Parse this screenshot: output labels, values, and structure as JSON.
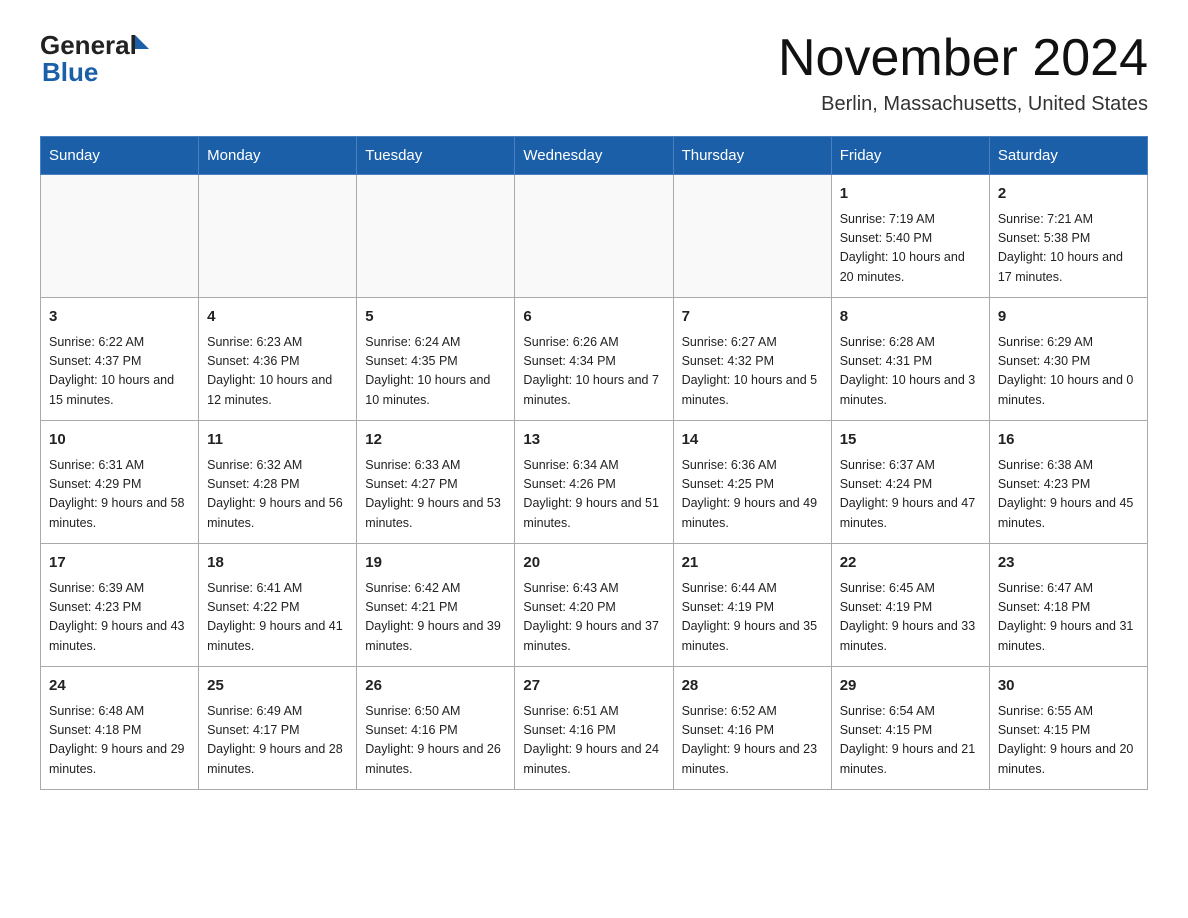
{
  "header": {
    "logo_general": "General",
    "logo_blue": "Blue",
    "main_title": "November 2024",
    "subtitle": "Berlin, Massachusetts, United States"
  },
  "calendar": {
    "days_of_week": [
      "Sunday",
      "Monday",
      "Tuesday",
      "Wednesday",
      "Thursday",
      "Friday",
      "Saturday"
    ],
    "weeks": [
      [
        {
          "day": "",
          "info": ""
        },
        {
          "day": "",
          "info": ""
        },
        {
          "day": "",
          "info": ""
        },
        {
          "day": "",
          "info": ""
        },
        {
          "day": "",
          "info": ""
        },
        {
          "day": "1",
          "info": "Sunrise: 7:19 AM\nSunset: 5:40 PM\nDaylight: 10 hours and 20 minutes."
        },
        {
          "day": "2",
          "info": "Sunrise: 7:21 AM\nSunset: 5:38 PM\nDaylight: 10 hours and 17 minutes."
        }
      ],
      [
        {
          "day": "3",
          "info": "Sunrise: 6:22 AM\nSunset: 4:37 PM\nDaylight: 10 hours and 15 minutes."
        },
        {
          "day": "4",
          "info": "Sunrise: 6:23 AM\nSunset: 4:36 PM\nDaylight: 10 hours and 12 minutes."
        },
        {
          "day": "5",
          "info": "Sunrise: 6:24 AM\nSunset: 4:35 PM\nDaylight: 10 hours and 10 minutes."
        },
        {
          "day": "6",
          "info": "Sunrise: 6:26 AM\nSunset: 4:34 PM\nDaylight: 10 hours and 7 minutes."
        },
        {
          "day": "7",
          "info": "Sunrise: 6:27 AM\nSunset: 4:32 PM\nDaylight: 10 hours and 5 minutes."
        },
        {
          "day": "8",
          "info": "Sunrise: 6:28 AM\nSunset: 4:31 PM\nDaylight: 10 hours and 3 minutes."
        },
        {
          "day": "9",
          "info": "Sunrise: 6:29 AM\nSunset: 4:30 PM\nDaylight: 10 hours and 0 minutes."
        }
      ],
      [
        {
          "day": "10",
          "info": "Sunrise: 6:31 AM\nSunset: 4:29 PM\nDaylight: 9 hours and 58 minutes."
        },
        {
          "day": "11",
          "info": "Sunrise: 6:32 AM\nSunset: 4:28 PM\nDaylight: 9 hours and 56 minutes."
        },
        {
          "day": "12",
          "info": "Sunrise: 6:33 AM\nSunset: 4:27 PM\nDaylight: 9 hours and 53 minutes."
        },
        {
          "day": "13",
          "info": "Sunrise: 6:34 AM\nSunset: 4:26 PM\nDaylight: 9 hours and 51 minutes."
        },
        {
          "day": "14",
          "info": "Sunrise: 6:36 AM\nSunset: 4:25 PM\nDaylight: 9 hours and 49 minutes."
        },
        {
          "day": "15",
          "info": "Sunrise: 6:37 AM\nSunset: 4:24 PM\nDaylight: 9 hours and 47 minutes."
        },
        {
          "day": "16",
          "info": "Sunrise: 6:38 AM\nSunset: 4:23 PM\nDaylight: 9 hours and 45 minutes."
        }
      ],
      [
        {
          "day": "17",
          "info": "Sunrise: 6:39 AM\nSunset: 4:23 PM\nDaylight: 9 hours and 43 minutes."
        },
        {
          "day": "18",
          "info": "Sunrise: 6:41 AM\nSunset: 4:22 PM\nDaylight: 9 hours and 41 minutes."
        },
        {
          "day": "19",
          "info": "Sunrise: 6:42 AM\nSunset: 4:21 PM\nDaylight: 9 hours and 39 minutes."
        },
        {
          "day": "20",
          "info": "Sunrise: 6:43 AM\nSunset: 4:20 PM\nDaylight: 9 hours and 37 minutes."
        },
        {
          "day": "21",
          "info": "Sunrise: 6:44 AM\nSunset: 4:19 PM\nDaylight: 9 hours and 35 minutes."
        },
        {
          "day": "22",
          "info": "Sunrise: 6:45 AM\nSunset: 4:19 PM\nDaylight: 9 hours and 33 minutes."
        },
        {
          "day": "23",
          "info": "Sunrise: 6:47 AM\nSunset: 4:18 PM\nDaylight: 9 hours and 31 minutes."
        }
      ],
      [
        {
          "day": "24",
          "info": "Sunrise: 6:48 AM\nSunset: 4:18 PM\nDaylight: 9 hours and 29 minutes."
        },
        {
          "day": "25",
          "info": "Sunrise: 6:49 AM\nSunset: 4:17 PM\nDaylight: 9 hours and 28 minutes."
        },
        {
          "day": "26",
          "info": "Sunrise: 6:50 AM\nSunset: 4:16 PM\nDaylight: 9 hours and 26 minutes."
        },
        {
          "day": "27",
          "info": "Sunrise: 6:51 AM\nSunset: 4:16 PM\nDaylight: 9 hours and 24 minutes."
        },
        {
          "day": "28",
          "info": "Sunrise: 6:52 AM\nSunset: 4:16 PM\nDaylight: 9 hours and 23 minutes."
        },
        {
          "day": "29",
          "info": "Sunrise: 6:54 AM\nSunset: 4:15 PM\nDaylight: 9 hours and 21 minutes."
        },
        {
          "day": "30",
          "info": "Sunrise: 6:55 AM\nSunset: 4:15 PM\nDaylight: 9 hours and 20 minutes."
        }
      ]
    ]
  }
}
